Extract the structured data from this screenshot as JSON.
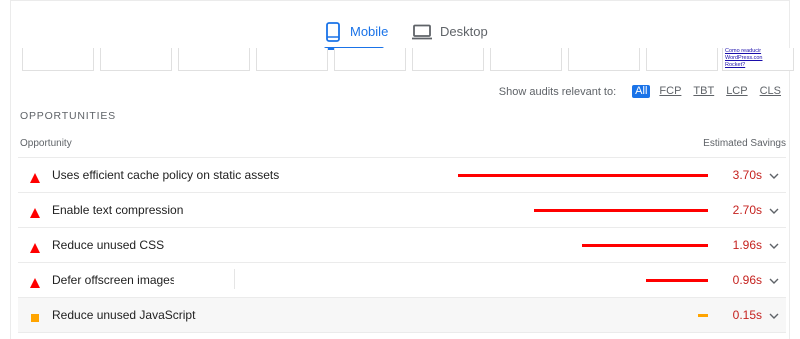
{
  "tabs": [
    {
      "label": "Mobile",
      "icon": "mobile-icon",
      "active": true
    },
    {
      "label": "Desktop",
      "icon": "desktop-icon",
      "active": false
    }
  ],
  "filmstrip": {
    "last_frame_text": [
      "Como readucir",
      "WordPress.con",
      "Rocket?"
    ]
  },
  "filter": {
    "label": "Show audits relevant to:",
    "options": [
      "All",
      "FCP",
      "TBT",
      "LCP",
      "CLS"
    ],
    "active": "All"
  },
  "section": {
    "title": "OPPORTUNITIES",
    "col_left": "Opportunity",
    "col_right": "Estimated Savings"
  },
  "colors": {
    "accent": "#1a73e8",
    "fail": "#ff0000",
    "fail_text": "#c5221f",
    "average": "#ffa400"
  },
  "audits": [
    {
      "title": "Uses efficient cache policy on static assets",
      "savings": "3.70s",
      "level": "fail",
      "marker": "red-triangle-icon"
    },
    {
      "title": "Enable text compression",
      "savings": "2.70s",
      "level": "fail",
      "marker": "red-triangle-icon"
    },
    {
      "title": "Reduce unused CSS",
      "savings": "1.96s",
      "level": "fail",
      "marker": "red-triangle-icon"
    },
    {
      "title": "Defer offscreen images",
      "savings": "0.96s",
      "level": "fail",
      "marker": "red-triangle-icon"
    },
    {
      "title": "Reduce unused JavaScript",
      "savings": "0.15s",
      "level": "average",
      "marker": "orange-square-icon"
    }
  ]
}
